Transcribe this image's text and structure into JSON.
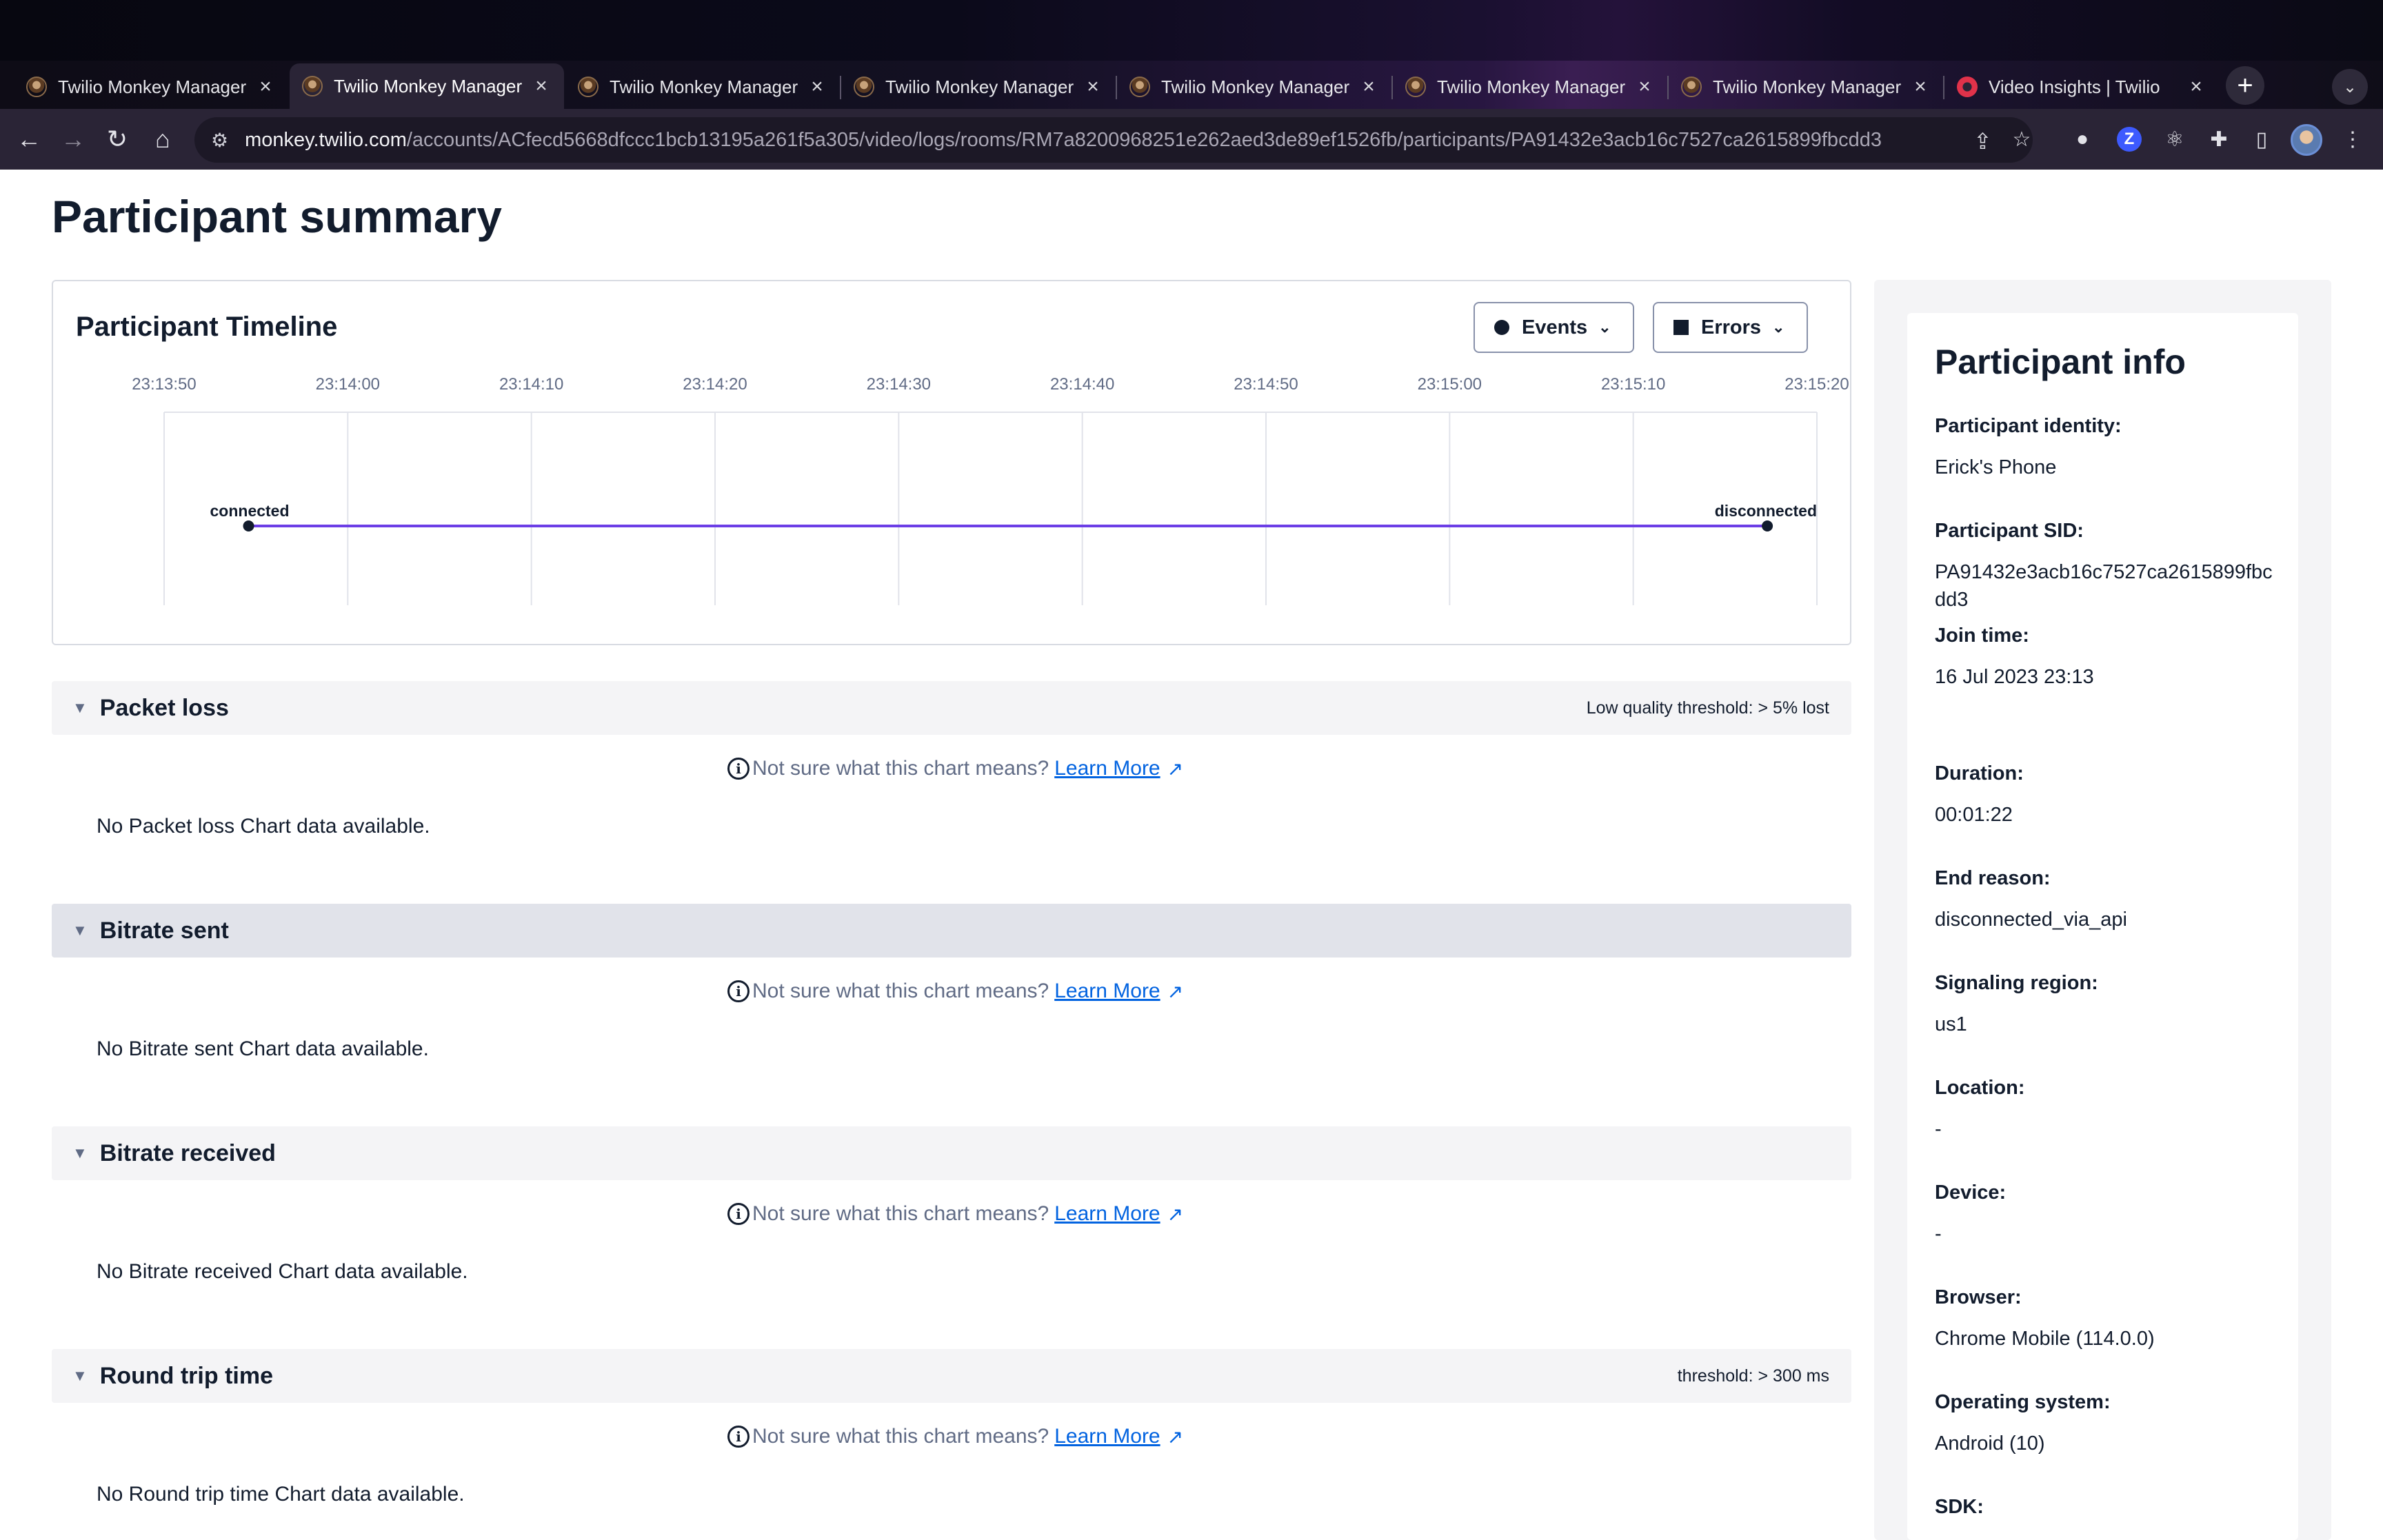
{
  "browser": {
    "tabs": [
      {
        "title": "Twilio Monkey Manager",
        "active": false
      },
      {
        "title": "Twilio Monkey Manager",
        "active": true
      },
      {
        "title": "Twilio Monkey Manager",
        "active": false
      },
      {
        "title": "Twilio Monkey Manager",
        "active": false
      },
      {
        "title": "Twilio Monkey Manager",
        "active": false
      },
      {
        "title": "Twilio Monkey Manager",
        "active": false
      },
      {
        "title": "Twilio Monkey Manager",
        "active": false
      },
      {
        "title": "Video Insights | Twilio",
        "active": false
      }
    ],
    "url_host": "monkey.twilio.com",
    "url_path": "/accounts/ACfecd5668dfccc1bcb13195a261f5a305/video/logs/rooms/RM7a8200968251e262aed3de89ef1526fb/participants/PA91432e3acb16c7527ca2615899fbcdd3",
    "icons": {
      "back": "arrow-left-icon",
      "forward": "arrow-right-icon",
      "reload": "reload-icon",
      "home": "home-icon",
      "site_info": "tune-icon",
      "share": "share-icon",
      "bookmark": "star-icon",
      "extensions": "puzzle-icon",
      "side_panel": "side-panel-icon",
      "menu": "kebab-menu-icon"
    }
  },
  "page": {
    "title": "Participant summary"
  },
  "timeline": {
    "title": "Participant Timeline",
    "events_label": "Events",
    "errors_label": "Errors"
  },
  "chart_data": {
    "type": "line",
    "title": "Participant Timeline",
    "x_ticks": [
      "23:13:50",
      "23:14:00",
      "23:14:10",
      "23:14:20",
      "23:14:30",
      "23:14:40",
      "23:14:50",
      "23:15:00",
      "23:15:10",
      "23:15:20"
    ],
    "x_range_seconds_after_first_tick": [
      0,
      90
    ],
    "events": [
      {
        "label": "connected",
        "seconds_after_first_tick": 4.6
      },
      {
        "label": "disconnected",
        "seconds_after_first_tick": 87.3
      }
    ],
    "line_color": "#6c3ee6",
    "grid": true
  },
  "sections": [
    {
      "title": "Packet loss",
      "threshold": "Low quality threshold: > 5% lost",
      "nodata": "No Packet loss Chart data available."
    },
    {
      "title": "Bitrate sent",
      "threshold": "",
      "nodata": "No Bitrate sent Chart data available."
    },
    {
      "title": "Bitrate received",
      "threshold": "",
      "nodata": "No Bitrate received Chart data available."
    },
    {
      "title": "Round trip time",
      "threshold": "threshold: > 300 ms",
      "nodata": "No Round trip time Chart data available."
    }
  ],
  "help": {
    "question": "Not sure what this chart means?",
    "link": " Learn More"
  },
  "participant_info": {
    "heading": "Participant info",
    "fields": [
      {
        "label": "Participant identity:",
        "value": "Erick's Phone"
      },
      {
        "label": "Participant SID:",
        "value": "PA91432e3acb16c7527ca2615899fbcdd3"
      },
      {
        "label": "Join time:",
        "value": "16 Jul 2023 23:13"
      },
      {
        "label": "Duration:",
        "value": "00:01:22"
      },
      {
        "label": "End reason:",
        "value": "disconnected_via_api"
      },
      {
        "label": "Signaling region:",
        "value": "us1"
      },
      {
        "label": "Location:",
        "value": "-"
      },
      {
        "label": "Device:",
        "value": "-"
      },
      {
        "label": "Browser:",
        "value": "Chrome Mobile (114.0.0)"
      },
      {
        "label": "Operating system:",
        "value": "Android (10)"
      },
      {
        "label": "SDK:",
        "value": ""
      }
    ]
  }
}
